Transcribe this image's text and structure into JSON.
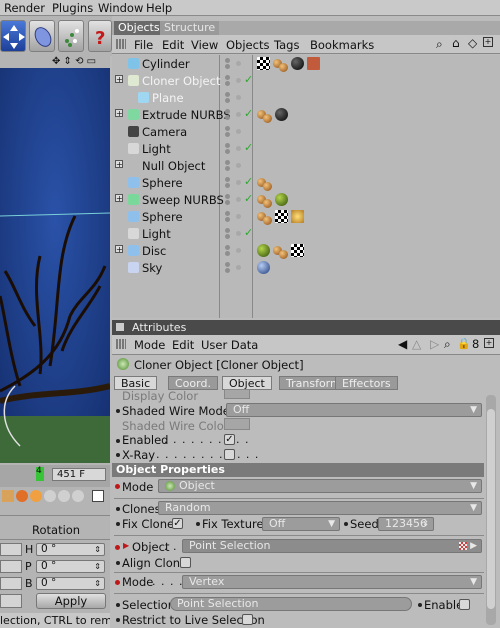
{
  "menubar": {
    "items": [
      "Render",
      "Plugins",
      "Window",
      "Help"
    ]
  },
  "viewport": {
    "frame_value": "451 F",
    "frame_marker": "4"
  },
  "coords": {
    "section_label": "Rotation",
    "rows": [
      {
        "axis": "H",
        "value": "0 °"
      },
      {
        "axis": "P",
        "value": "0 °"
      },
      {
        "axis": "B",
        "value": "0 °"
      }
    ],
    "apply_label": "Apply"
  },
  "status_bar": {
    "text": "lection, CTRL to remov"
  },
  "object_manager": {
    "tabs": [
      "Objects",
      "Structure"
    ],
    "menu": [
      "File",
      "Edit",
      "View",
      "Objects",
      "Tags",
      "Bookmarks"
    ],
    "objects": [
      {
        "name": "Cylinder",
        "checked": false,
        "dim": false,
        "tags": [
          "check2",
          "pair",
          "ball",
          "red"
        ]
      },
      {
        "name": "Cloner Object",
        "checked": true,
        "dim": true,
        "tags": []
      },
      {
        "name": "Plane",
        "checked": false,
        "dim": true,
        "tags": []
      },
      {
        "name": "Extrude NURBS",
        "checked": true,
        "dim": false,
        "tags": [
          "pair",
          "ball"
        ]
      },
      {
        "name": "Camera",
        "checked": false,
        "dim": false,
        "tags": []
      },
      {
        "name": "Light",
        "checked": true,
        "dim": false,
        "tags": []
      },
      {
        "name": "Null Object",
        "checked": false,
        "dim": false,
        "tags": []
      },
      {
        "name": "Sphere",
        "checked": true,
        "dim": false,
        "tags": [
          "pair"
        ]
      },
      {
        "name": "Sweep NURBS",
        "checked": true,
        "dim": false,
        "tags": [
          "pair",
          "green"
        ]
      },
      {
        "name": "Sphere",
        "checked": false,
        "dim": false,
        "tags": [
          "pair",
          "check2",
          "spark"
        ]
      },
      {
        "name": "Light",
        "checked": true,
        "dim": false,
        "tags": []
      },
      {
        "name": "Disc",
        "checked": false,
        "dim": false,
        "tags": [
          "green",
          "pair",
          "check2"
        ]
      },
      {
        "name": "Sky",
        "checked": false,
        "dim": false,
        "tags": [
          "blue"
        ]
      }
    ]
  },
  "attributes": {
    "title": "Attributes",
    "menu": [
      "Mode",
      "Edit",
      "User Data"
    ],
    "page_number": "8",
    "object_header": "Cloner Object [Cloner Object]",
    "tabs": [
      "Basic",
      "Coord.",
      "Object",
      "Transform",
      "Effectors"
    ],
    "basic": {
      "display_color_label": "Display Color",
      "shaded_wire_mode_label": "Shaded Wire Mode",
      "shaded_wire_mode_value": "Off",
      "shaded_wire_color_label": "Shaded Wire Color",
      "enabled_label": "Enabled",
      "xray_label": "X-Ray"
    },
    "section_title": "Object Properties",
    "mode_label": "Mode",
    "mode_value": "Object",
    "clones_label": "Clones",
    "clones_value": "Random",
    "fix_clone_label": "Fix Clone",
    "fix_texture_label": "Fix Texture",
    "fix_texture_value": "Off",
    "seed_label": "Seed",
    "seed_value": "123456",
    "object_label": "Object",
    "object_value": "Point Selection",
    "align_clone_label": "Align Clone",
    "mode2_label": "Mode",
    "mode2_value": "Vertex",
    "selection_label": "Selection",
    "selection_value": "Point Selection",
    "enable_label": "Enable",
    "restrict_label": "Restrict to Live Selection"
  }
}
